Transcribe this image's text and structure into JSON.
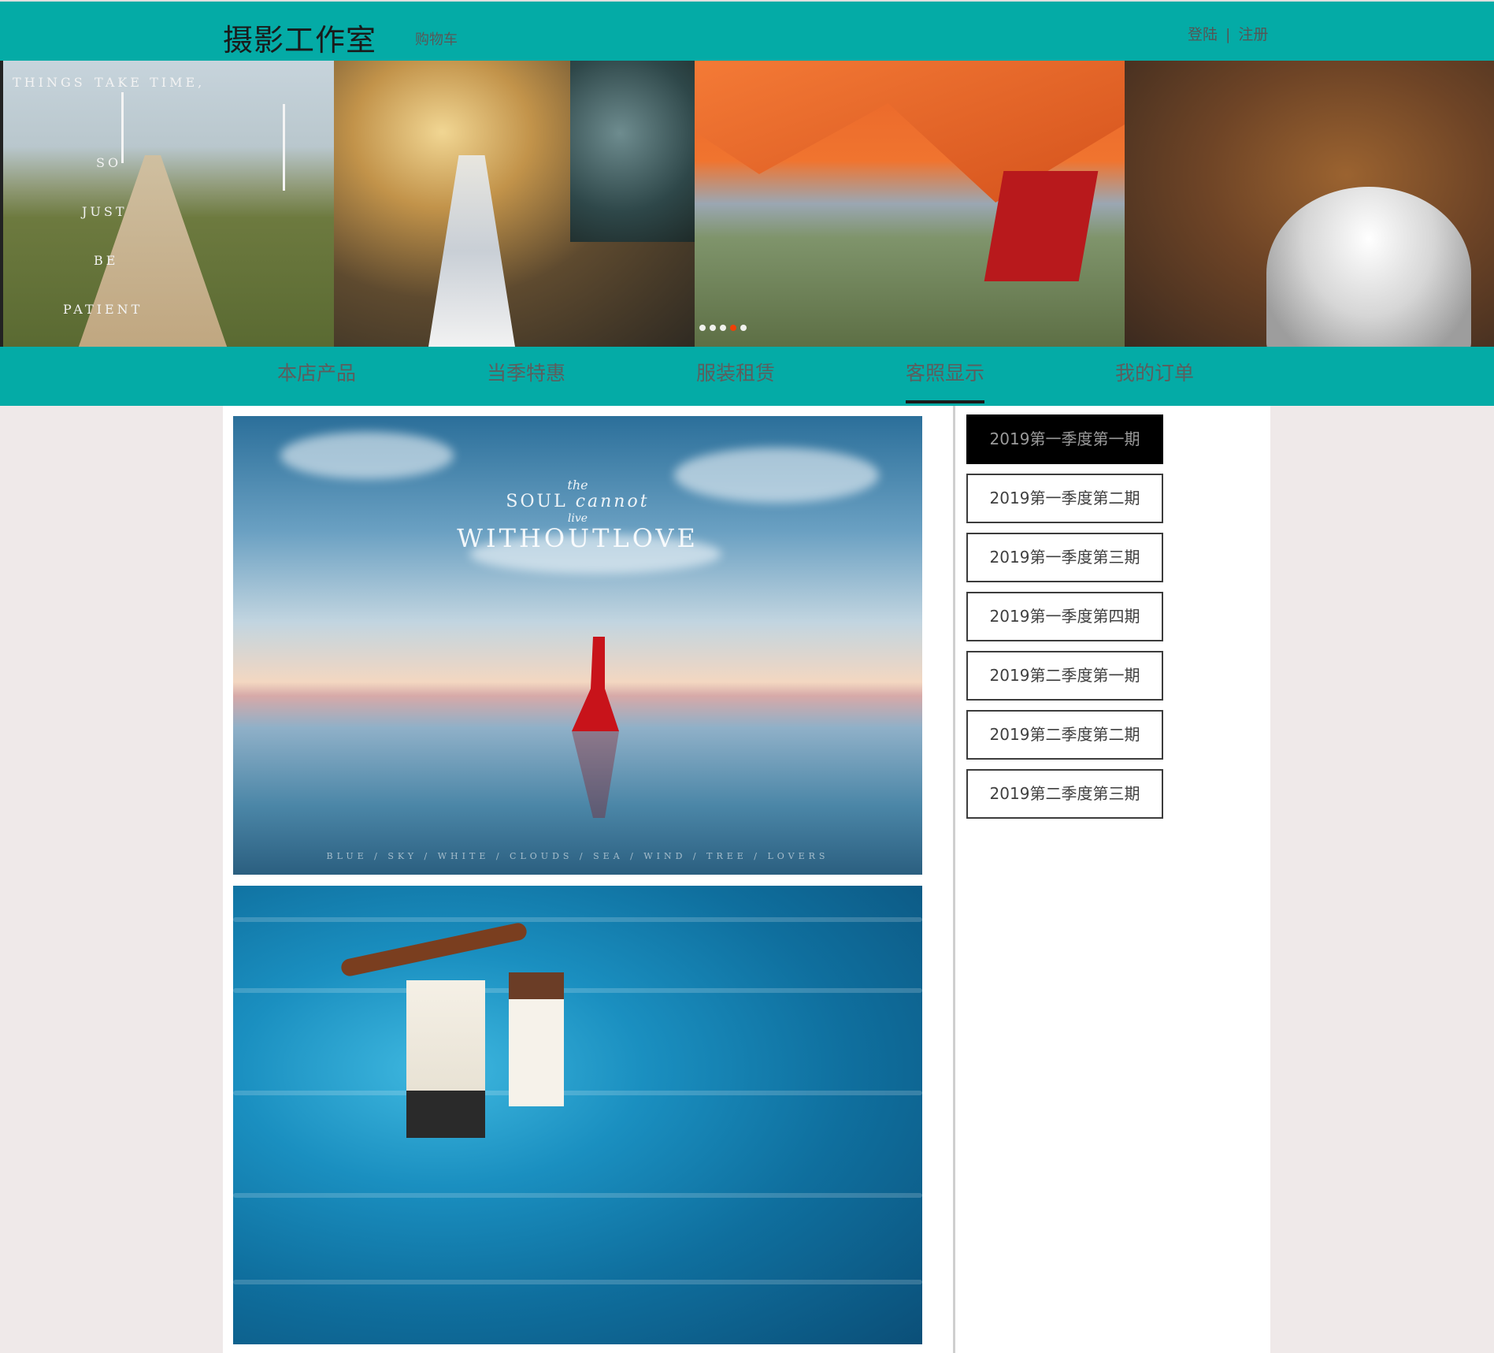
{
  "header": {
    "logo": "摄影工作室",
    "cart": "购物车",
    "login": "登陆",
    "separator": "|",
    "register": "注册"
  },
  "banner": {
    "slide1_text": [
      "THINGS",
      "TAKE TIME,",
      "SO",
      "JUST",
      "BE",
      "PATIENT"
    ],
    "dots_count": 5,
    "active_dot_index": 3
  },
  "nav": {
    "items": [
      {
        "label": "本店产品"
      },
      {
        "label": "当季特惠"
      },
      {
        "label": "服装租赁"
      },
      {
        "label": "客照显示",
        "active": true
      },
      {
        "label": "我的订单"
      }
    ]
  },
  "photos": {
    "p1_small": "the",
    "p1_mid": "SOUL",
    "p1_script": "cannot",
    "p1_live": "live",
    "p1_big": "WITHOUTLOVE",
    "p1_footer": "BLUE / SKY / WHITE / CLOUDS / SEA / WIND / TREE / LOVERS"
  },
  "issues": {
    "items": [
      {
        "label": "2019第一季度第一期",
        "active": true
      },
      {
        "label": "2019第一季度第二期"
      },
      {
        "label": "2019第一季度第三期"
      },
      {
        "label": "2019第一季度第四期"
      },
      {
        "label": "2019第二季度第一期"
      },
      {
        "label": "2019第二季度第二期"
      },
      {
        "label": "2019第二季度第三期"
      }
    ]
  },
  "colors": {
    "teal": "#04aba6",
    "page_bg": "#efe9e9",
    "active_issue_bg": "#000000"
  }
}
